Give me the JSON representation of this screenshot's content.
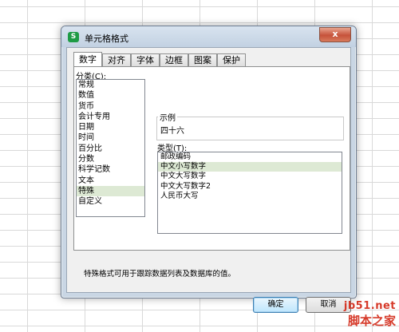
{
  "window": {
    "title": "单元格格式",
    "icon": "wps-s-icon",
    "close_label": "x"
  },
  "tabs": [
    {
      "label": "数字",
      "active": true
    },
    {
      "label": "对齐",
      "active": false
    },
    {
      "label": "字体",
      "active": false
    },
    {
      "label": "边框",
      "active": false
    },
    {
      "label": "图案",
      "active": false
    },
    {
      "label": "保护",
      "active": false
    }
  ],
  "category": {
    "label": "分类(C):",
    "items": [
      "常规",
      "数值",
      "货币",
      "会计专用",
      "日期",
      "时间",
      "百分比",
      "分数",
      "科学记数",
      "文本",
      "特殊",
      "自定义"
    ],
    "selected": "特殊"
  },
  "sample": {
    "label": "示例",
    "value": "四十六"
  },
  "type": {
    "label": "类型(T):",
    "items": [
      "邮政编码",
      "中文小写数字",
      "中文大写数字",
      "中文大写数字2",
      "人民币大写"
    ],
    "selected": "中文小写数字"
  },
  "description": "特殊格式可用于跟踪数据列表及数据库的值。",
  "buttons": {
    "ok": "确定",
    "cancel": "取消"
  },
  "watermark": {
    "site": "jb51.net",
    "name": "脚本之家"
  }
}
